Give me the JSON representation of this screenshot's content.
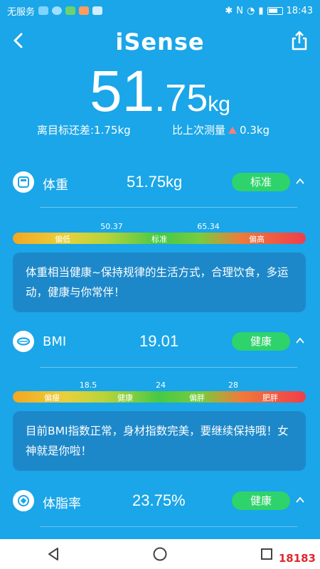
{
  "status": {
    "carrier": "无服务",
    "time": "18:43"
  },
  "header": {
    "title": "iSense"
  },
  "weight": {
    "integer": "51",
    "decimal": ".75",
    "unit": "kg"
  },
  "diff": {
    "target": "离目标还差:1.75kg",
    "last_label": "比上次测量",
    "last_value": "0.3kg"
  },
  "body_weight": {
    "label": "体重",
    "value": "51.75kg",
    "status": "标准",
    "thresholds": [
      "50.37",
      "65.34"
    ],
    "zones": [
      "偏低",
      "标准",
      "偏高"
    ],
    "note": "体重相当健康~保持规律的生活方式，合理饮食，多运动，健康与你常伴！"
  },
  "bmi": {
    "label": "BMI",
    "value": "19.01",
    "status": "健康",
    "thresholds": [
      "18.5",
      "24",
      "28"
    ],
    "zones": [
      "偏瘦",
      "健康",
      "偏胖",
      "肥胖"
    ],
    "note": "目前BMI指数正常，身材指数完美，要继续保持哦！女神就是你啦！"
  },
  "body_fat": {
    "label": "体脂率",
    "value": "23.75%",
    "status": "健康"
  },
  "watermark": "18183",
  "colors": {
    "background": "#1aa6e8",
    "badge": "#2fd36b",
    "note_bg": "#1d88c9"
  }
}
